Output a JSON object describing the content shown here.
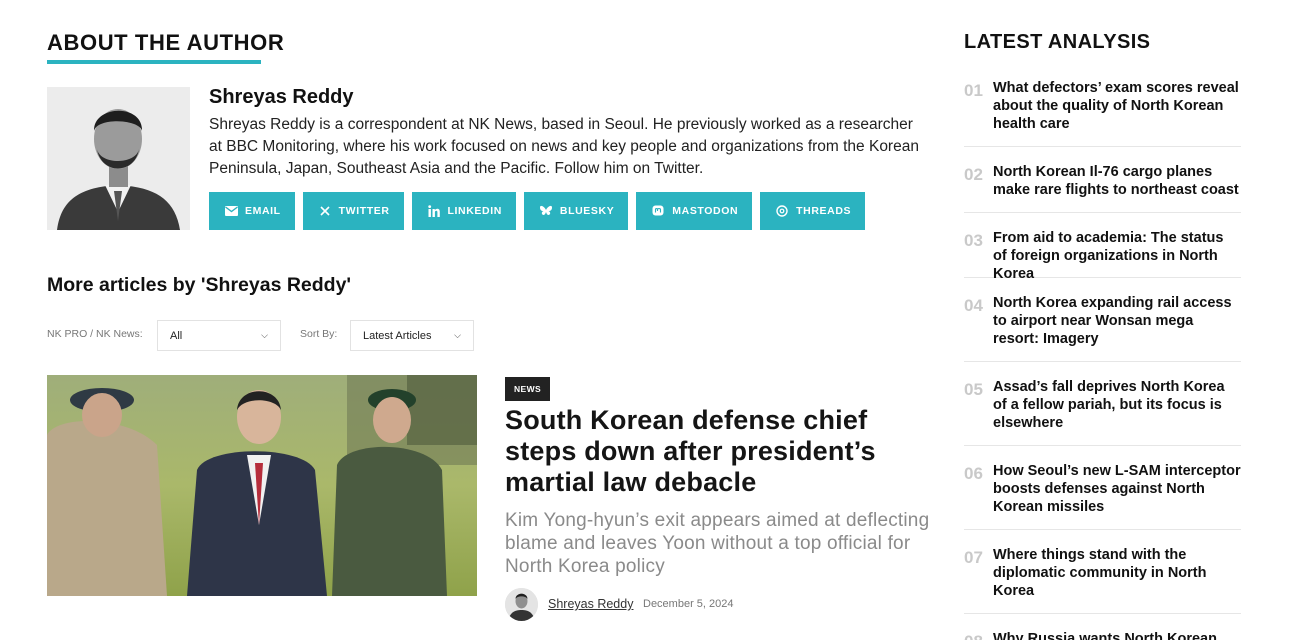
{
  "author_section": {
    "heading": "ABOUT THE AUTHOR",
    "name": "Shreyas Reddy",
    "bio": "Shreyas Reddy is a correspondent at NK News, based in Seoul. He previously worked as a researcher at BBC Monitoring, where his work focused on news and key people and organizations from the Korean Peninsula, Japan, Southeast Asia and the Pacific. Follow him on Twitter.",
    "social_buttons": [
      {
        "label": "EMAIL",
        "icon": "envelope-icon"
      },
      {
        "label": "TWITTER",
        "icon": "x-icon"
      },
      {
        "label": "LINKEDIN",
        "icon": "linkedin-icon"
      },
      {
        "label": "BLUESKY",
        "icon": "butterfly-icon"
      },
      {
        "label": "MASTODON",
        "icon": "mastodon-icon"
      },
      {
        "label": "THREADS",
        "icon": "threads-icon"
      }
    ],
    "accent_color": "#2bb3c0"
  },
  "more_articles": {
    "heading": "More articles by 'Shreyas Reddy'",
    "filter_label": "NK PRO / NK News:",
    "filter_value": "All",
    "sort_label": "Sort By:",
    "sort_value": "Latest Articles"
  },
  "featured_article": {
    "badge": "NEWS",
    "title": "South Korean defense chief steps down after president’s martial law debacle",
    "subtitle": "Kim Yong-hyun’s exit appears aimed at deflecting blame and leaves Yoon without a top official for North Korea policy",
    "author": "Shreyas Reddy",
    "date": "December 5, 2024"
  },
  "latest_analysis": {
    "heading": "LATEST ANALYSIS",
    "items": [
      {
        "num": "01",
        "title": "What defectors’ exam scores reveal about the quality of North Korean health care"
      },
      {
        "num": "02",
        "title": "North Korean Il-76 cargo planes make rare flights to northeast coast"
      },
      {
        "num": "03",
        "title": "From aid to academia: The status of foreign organizations in North Korea"
      },
      {
        "num": "04",
        "title": "North Korea expanding rail access to airport near Wonsan mega resort: Imagery"
      },
      {
        "num": "05",
        "title": "Assad’s fall deprives North Korea of a fellow pariah, but its focus is elsewhere"
      },
      {
        "num": "06",
        "title": "How Seoul’s new L-SAM interceptor boosts defenses against North Korean missiles"
      },
      {
        "num": "07",
        "title": "Where things stand with the diplomatic community in North Korea"
      },
      {
        "num": "08",
        "title": "Why Russia wants North Korean"
      }
    ]
  }
}
